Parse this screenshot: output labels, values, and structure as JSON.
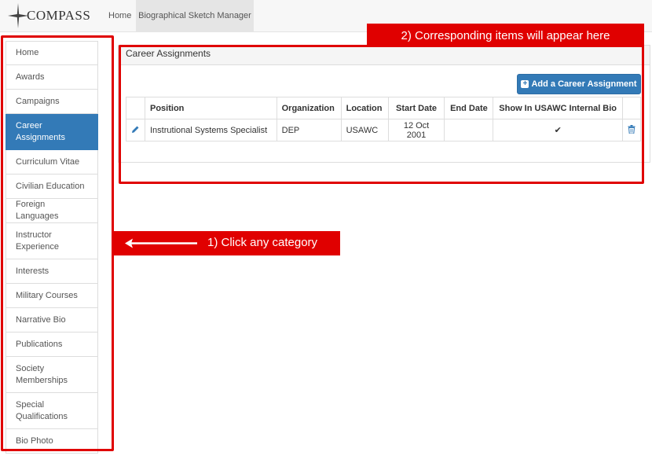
{
  "app": {
    "logo_text": "Compass",
    "nav": {
      "home_label": "Home",
      "bio_label": "Biographical Sketch Manager"
    }
  },
  "sidebar": {
    "items": [
      {
        "label": "Home"
      },
      {
        "label": "Awards"
      },
      {
        "label": "Campaigns"
      },
      {
        "label": "Career Assignments",
        "active": true
      },
      {
        "label": "Curriculum Vitae"
      },
      {
        "label": "Civilian Education"
      },
      {
        "label": "Foreign Languages"
      },
      {
        "label": "Instructor Experience"
      },
      {
        "label": "Interests"
      },
      {
        "label": "Military Courses"
      },
      {
        "label": "Narrative Bio"
      },
      {
        "label": "Publications"
      },
      {
        "label": "Society Memberships"
      },
      {
        "label": "Special Qualifications"
      },
      {
        "label": "Bio Photo"
      }
    ]
  },
  "main": {
    "panel_title": "Career Assignments",
    "add_button_label": "Add a Career Assignment",
    "table": {
      "headers": [
        "Position",
        "Organization",
        "Location",
        "Start Date",
        "End Date",
        "Show In USAWC Internal Bio"
      ],
      "rows": [
        {
          "position": "Instrutional Systems Specialist",
          "organization": "DEP",
          "location": "USAWC",
          "start_date": "12 Oct 2001",
          "end_date": "",
          "show_in_bio": "✔"
        }
      ]
    }
  },
  "annotations": {
    "top_callout": "2) Corresponding items will appear here",
    "left_callout": "1) Click any category"
  },
  "colors": {
    "accent": "#337ab7",
    "annotation_red": "#e00000"
  },
  "icons": {
    "edit": "pencil-icon",
    "delete": "trash-icon",
    "add": "plus-square-icon",
    "arrow": "arrow-left-icon"
  }
}
